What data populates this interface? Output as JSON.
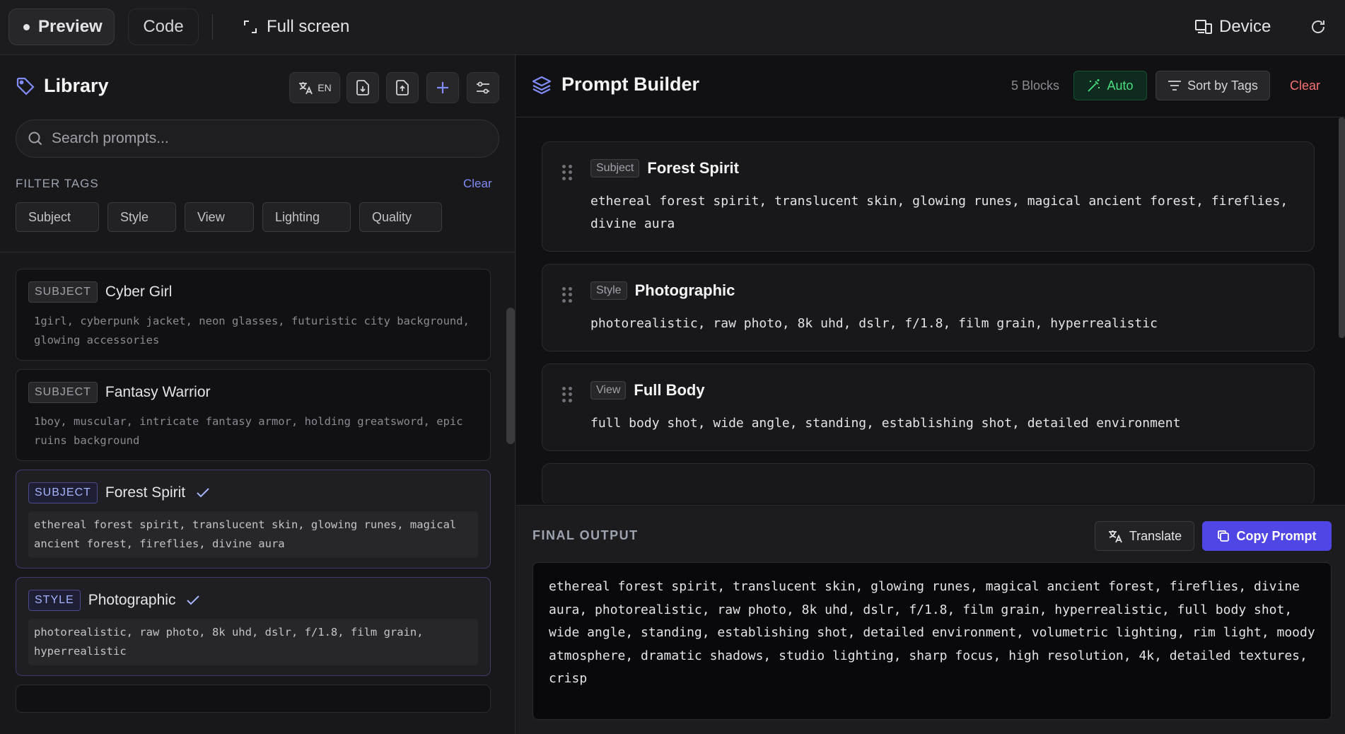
{
  "topbar": {
    "preview_label": "Preview",
    "code_label": "Code",
    "fullscreen_label": "Full screen",
    "device_label": "Device"
  },
  "library": {
    "title": "Library",
    "lang_label": "EN",
    "search_placeholder": "Search prompts...",
    "filter_label": "FILTER TAGS",
    "clear_label": "Clear",
    "tags": [
      "Subject",
      "Style",
      "View",
      "Lighting",
      "Quality"
    ],
    "items": [
      {
        "badge": "SUBJECT",
        "name": "Cyber Girl",
        "selected": false,
        "text": "1girl, cyberpunk jacket, neon glasses, futuristic city background, glowing accessories"
      },
      {
        "badge": "SUBJECT",
        "name": "Fantasy Warrior",
        "selected": false,
        "text": "1boy, muscular, intricate fantasy armor, holding greatsword, epic ruins background"
      },
      {
        "badge": "SUBJECT",
        "name": "Forest Spirit",
        "selected": true,
        "text": "ethereal forest spirit, translucent skin, glowing runes, magical ancient forest, fireflies, divine aura"
      },
      {
        "badge": "STYLE",
        "name": "Photographic",
        "selected": true,
        "text": "photorealistic, raw photo, 8k uhd, dslr, f/1.8, film grain, hyperrealistic"
      }
    ]
  },
  "builder": {
    "title": "Prompt Builder",
    "blocks_count": "5 Blocks",
    "auto_label": "Auto",
    "sort_label": "Sort by Tags",
    "clear_label": "Clear",
    "blocks": [
      {
        "tag": "Subject",
        "name": "Forest Spirit",
        "text": "ethereal forest spirit, translucent skin, glowing runes, magical ancient forest, fireflies, divine aura"
      },
      {
        "tag": "Style",
        "name": "Photographic",
        "text": "photorealistic, raw photo, 8k uhd, dslr, f/1.8, film grain, hyperrealistic"
      },
      {
        "tag": "View",
        "name": "Full Body",
        "text": "full body shot, wide angle, standing, establishing shot, detailed environment"
      }
    ]
  },
  "output": {
    "label": "FINAL OUTPUT",
    "translate_label": "Translate",
    "copy_label": "Copy Prompt",
    "text": "ethereal forest spirit, translucent skin, glowing runes, magical ancient forest, fireflies, divine aura, photorealistic, raw photo, 8k uhd, dslr, f/1.8, film grain, hyperrealistic, full body shot, wide angle, standing, establishing shot, detailed environment, volumetric lighting, rim light, moody atmosphere, dramatic shadows, studio lighting, sharp focus, high resolution, 4k, detailed textures, crisp"
  },
  "colors": {
    "accent": "#4f46e5",
    "auto_green": "#4ade80",
    "clear_red": "#f87171",
    "link_blue": "#818cf8"
  }
}
